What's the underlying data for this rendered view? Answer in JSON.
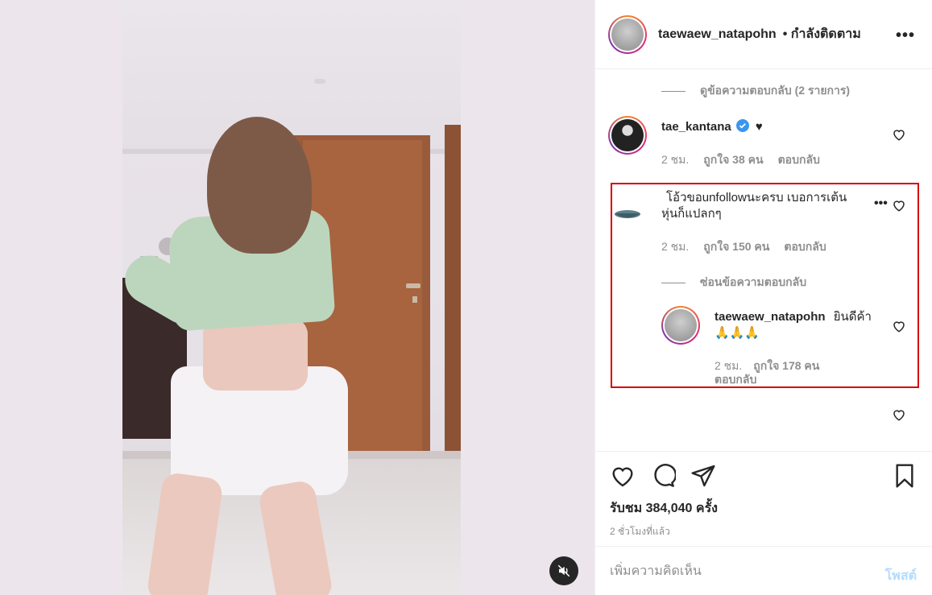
{
  "header": {
    "username": "taewaew_natapohn",
    "follow_status": "• กำลังติดตาม",
    "more_icon": "more-dots-icon"
  },
  "comments": {
    "view_replies_label": "ดูข้อความตอบกลับ (2 รายการ)",
    "items": [
      {
        "username": "tae_kantana",
        "text": "♥",
        "verified": true,
        "time": "2 ชม.",
        "likes": "ถูกใจ 38 คน",
        "reply": "ตอบกลับ"
      },
      {
        "username": "",
        "text": "โอ้วขอunfollowนะครบ เบอการเต้นหุ่นก็แปลกๆ",
        "time": "2 ชม.",
        "likes": "ถูกใจ 150 คน",
        "reply": "ตอบกลับ"
      }
    ],
    "hide_replies_label": "ซ่อนข้อความตอบกลับ",
    "reply": {
      "username": "taewaew_natapohn",
      "text": "ยินดีค้า🙏🙏🙏",
      "time": "2 ชม.",
      "likes": "ถูกใจ 178 คน",
      "reply": "ตอบกลับ"
    }
  },
  "actions": {
    "views": "รับชม 384,040 ครั้ง",
    "time_ago": "2 ชั่วโมงที่แล้ว"
  },
  "add_comment": {
    "placeholder": "เพิ่มความคิดเห็น",
    "post_label": "โพสต์"
  },
  "colors": {
    "highlight": "#d80000",
    "verified": "#3897f0",
    "post_disabled": "#b3dbff"
  }
}
